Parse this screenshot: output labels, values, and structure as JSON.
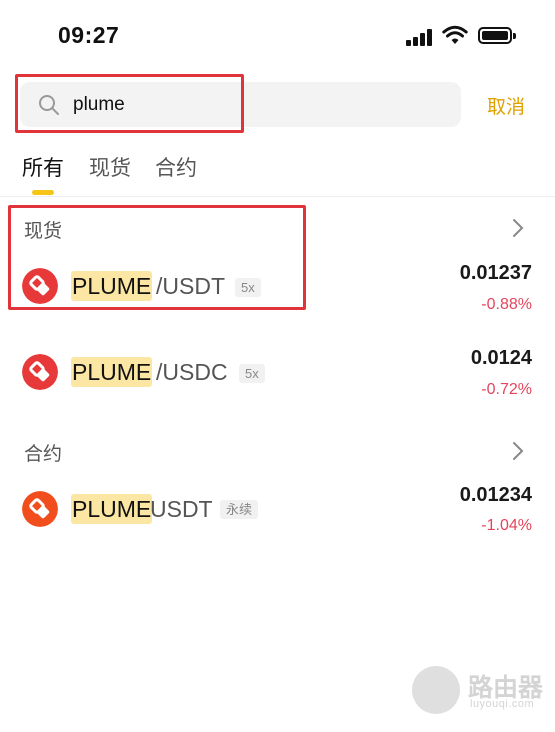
{
  "status_bar": {
    "time": "09:27"
  },
  "search": {
    "value": "plume",
    "cancel_label": "取消"
  },
  "tabs": [
    {
      "label": "所有",
      "active": true
    },
    {
      "label": "现货",
      "active": false
    },
    {
      "label": "合约",
      "active": false
    }
  ],
  "sections": {
    "spot": {
      "title": "现货",
      "rows": [
        {
          "base": "PLUME",
          "quote": "/USDT",
          "tag": "5x",
          "price": "0.01237",
          "change": "-0.88%"
        },
        {
          "base": "PLUME",
          "quote": "/USDC",
          "tag": "5x",
          "price": "0.0124",
          "change": "-0.72%"
        }
      ]
    },
    "futures": {
      "title": "合约",
      "rows": [
        {
          "base": "PLUME",
          "quote": "USDT",
          "tag": "永续",
          "price": "0.01234",
          "change": "-1.04%"
        }
      ]
    }
  },
  "watermark": {
    "text": "路由器",
    "url": "luyouqi.com"
  },
  "colors": {
    "accent": "#f5c518",
    "cancel": "#e0a100",
    "negative": "#e5455b",
    "highlight": "#fbe6a4",
    "annotation": "#e0343a",
    "coin_spot": "#e8393a",
    "coin_futures": "#f24d1d"
  }
}
